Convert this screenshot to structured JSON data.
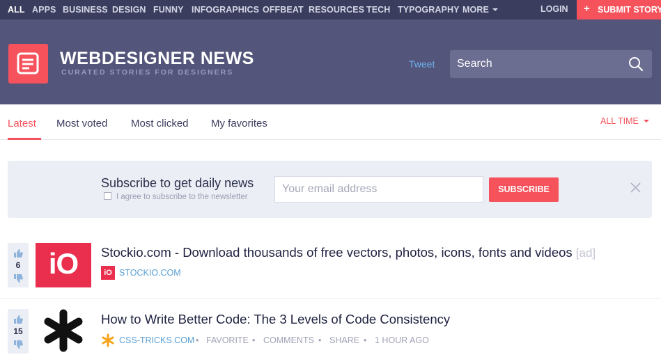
{
  "topnav": {
    "categories": [
      "ALL",
      "APPS",
      "BUSINESS",
      "DESIGN",
      "FUNNY",
      "INFOGRAPHICS",
      "OFFBEAT",
      "RESOURCES",
      "TECH",
      "TYPOGRAPHY",
      "MORE"
    ],
    "login": "LOGIN",
    "submit": "SUBMIT STORY"
  },
  "header": {
    "title": "WEBDESIGNER NEWS",
    "subtitle": "CURATED STORIES FOR DESIGNERS",
    "tweet": "Tweet",
    "search_placeholder": "Search"
  },
  "tabs": {
    "items": [
      "Latest",
      "Most voted",
      "Most clicked",
      "My favorites"
    ],
    "active": "Latest",
    "range": "ALL TIME"
  },
  "subscribe": {
    "title": "Subscribe to get daily news",
    "agree": "I agree to subscribe to the newsletter",
    "email_placeholder": "Your email address",
    "button": "SUBSCRIBE"
  },
  "stories": [
    {
      "votes": "6",
      "title": "Stockio.com - Download thousands of free vectors, photos, icons, fonts and videos",
      "ad": "[ad]",
      "source": "STOCKIO.COM",
      "thumb_text": "iO",
      "favicon_text": "iO"
    },
    {
      "votes": "15",
      "title": "How to Write Better Code: The 3 Levels of Code Consistency",
      "source": "CSS-TRICKS.COM",
      "actions": [
        "FAVORITE",
        "COMMENTS",
        "SHARE"
      ],
      "time": "1 HOUR AGO",
      "separator": "•"
    }
  ],
  "colors": {
    "accent": "#f5525c",
    "nav_bg": "#3b3d5e",
    "header_bg": "#53557a",
    "link": "#5a9fd4"
  }
}
